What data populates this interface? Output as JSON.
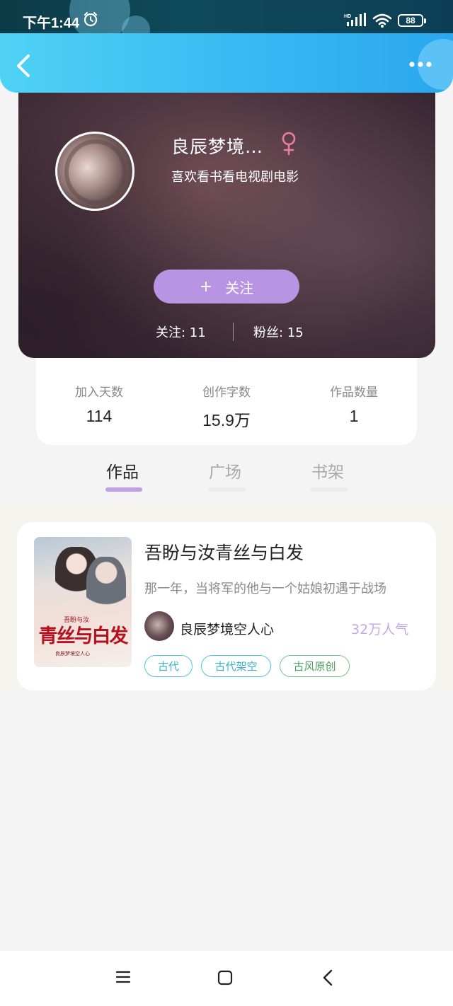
{
  "status_bar": {
    "time": "下午1:44",
    "network_label": "HD",
    "battery": "88",
    "icons": [
      "alarm-icon",
      "signal-icon",
      "wifi-icon",
      "battery-icon"
    ]
  },
  "header": {
    "back_icon": "chevron-left-icon",
    "more_icon": "more-dots-icon",
    "accent_color": "#38b9f2"
  },
  "profile": {
    "name": "良辰梦境…",
    "gender_symbol": "♀",
    "gender_color": "#e87fa0",
    "bio": "喜欢看书看电视剧电影",
    "follow_button": {
      "icon": "+",
      "label": "关注",
      "color": "#b894e2"
    },
    "following": "关注: 11",
    "fans": "粉丝: 15"
  },
  "stats": [
    {
      "label": "加入天数",
      "value": "114"
    },
    {
      "label": "创作字数",
      "value": "15.9万"
    },
    {
      "label": "作品数量",
      "value": "1"
    }
  ],
  "tabs": [
    {
      "label": "作品",
      "active": true
    },
    {
      "label": "广场",
      "active": false
    },
    {
      "label": "书架",
      "active": false
    }
  ],
  "tab_indicator_color": "#c0a0e4",
  "book": {
    "title": "吾盼与汝青丝与白发",
    "description": "那一年，当将军的他与一个姑娘初遇于战场",
    "cover": {
      "subtitle": "吾盼与汝",
      "title": "青丝与白发",
      "author": "良辰梦境空人心"
    },
    "author": "良辰梦境空人心",
    "popularity": "32万人气",
    "tags": [
      "古代",
      "古代架空",
      "古风原创"
    ]
  },
  "nav_bar": {
    "icons": [
      "menu-icon",
      "home-square-icon",
      "back-icon"
    ]
  }
}
